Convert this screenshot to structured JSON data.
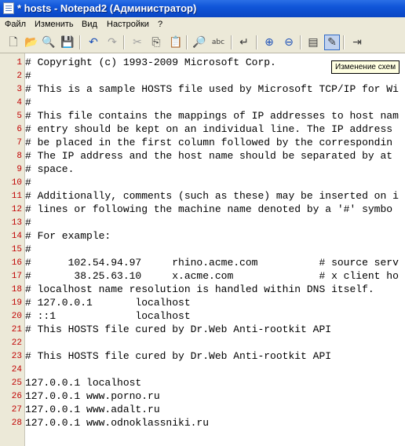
{
  "window": {
    "title": "* hosts - Notepad2 (Администратор)"
  },
  "menu": [
    "Файл",
    "Изменить",
    "Вид",
    "Настройки",
    "?"
  ],
  "toolbar": [
    {
      "name": "new-file-icon",
      "glyph": "🗋"
    },
    {
      "name": "open-file-icon",
      "glyph": "📂"
    },
    {
      "name": "browse-icon",
      "glyph": "🔍"
    },
    {
      "name": "save-icon",
      "glyph": "💾"
    },
    {
      "name": "undo-icon",
      "glyph": "↶"
    },
    {
      "name": "redo-icon",
      "glyph": "↷"
    },
    {
      "name": "cut-icon",
      "glyph": "✂"
    },
    {
      "name": "copy-icon",
      "glyph": "⎘"
    },
    {
      "name": "paste-icon",
      "glyph": "📋"
    },
    {
      "name": "find-icon",
      "glyph": "🔎"
    },
    {
      "name": "replace-icon",
      "glyph": "abc"
    },
    {
      "name": "goto-icon",
      "glyph": "↵"
    },
    {
      "name": "zoom-in-icon",
      "glyph": "⊕"
    },
    {
      "name": "zoom-out-icon",
      "glyph": "⊖"
    },
    {
      "name": "scheme-icon",
      "glyph": "▤"
    },
    {
      "name": "customize-schemes-icon",
      "glyph": "✎"
    },
    {
      "name": "exit-icon",
      "glyph": "⇥"
    }
  ],
  "tooltip": "Изменение схем",
  "lines": [
    "# Copyright (c) 1993-2009 Microsoft Corp.",
    "#",
    "# This is a sample HOSTS file used by Microsoft TCP/IP for Wi",
    "#",
    "# This file contains the mappings of IP addresses to host nam",
    "# entry should be kept on an individual line. The IP address",
    "# be placed in the first column followed by the correspondin",
    "# The IP address and the host name should be separated by at",
    "# space.",
    "#",
    "# Additionally, comments (such as these) may be inserted on i",
    "# lines or following the machine name denoted by a '#' symbo",
    "#",
    "# For example:",
    "#",
    "#      102.54.94.97     rhino.acme.com          # source serv",
    "#       38.25.63.10     x.acme.com              # x client ho",
    "# localhost name resolution is handled within DNS itself.",
    "# 127.0.0.1       localhost",
    "# ::1             localhost",
    "# This HOSTS file cured by Dr.Web Anti-rootkit API",
    "",
    "# This HOSTS file cured by Dr.Web Anti-rootkit API",
    "",
    "127.0.0.1 localhost",
    "127.0.0.1 www.porno.ru",
    "127.0.0.1 www.adalt.ru",
    "127.0.0.1 www.odnoklassniki.ru"
  ],
  "line_numbers": [
    "1",
    "2",
    "3",
    "4",
    "5",
    "6",
    "7",
    "8",
    "9",
    "10",
    "11",
    "12",
    "13",
    "14",
    "15",
    "16",
    "17",
    "18",
    "19",
    "20",
    "21",
    "22",
    "23",
    "24",
    "25",
    "26",
    "27",
    "28"
  ]
}
